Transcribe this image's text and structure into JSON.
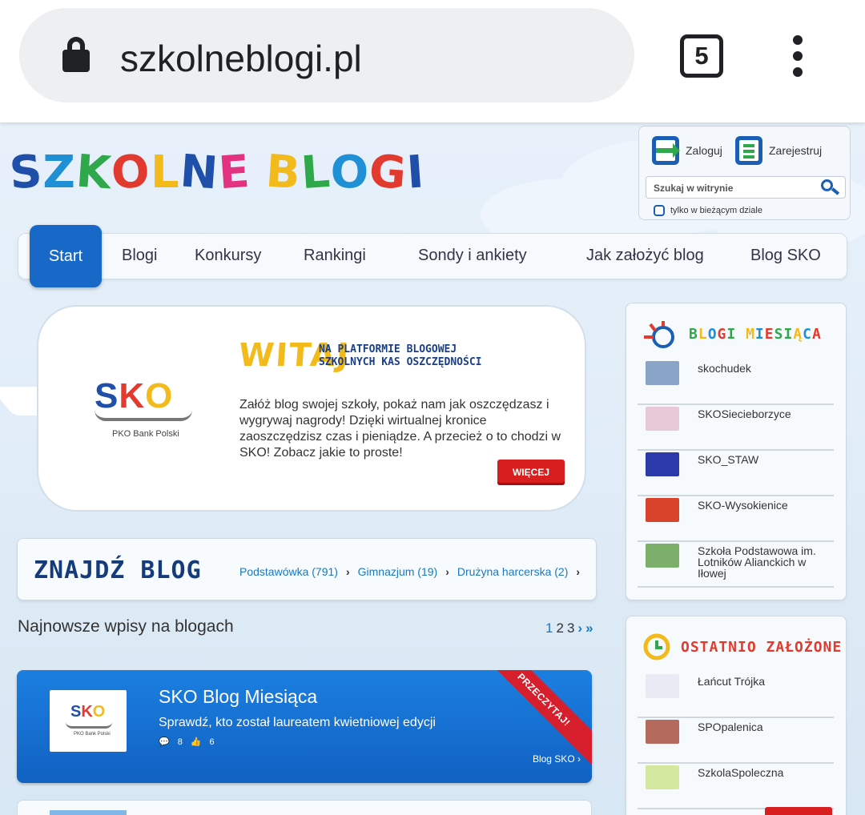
{
  "browser": {
    "url": "szkolneblogi.pl",
    "tab_count": "5"
  },
  "header": {
    "logo_letters": [
      "S",
      "Z",
      "K",
      "O",
      "L",
      "N",
      "E",
      " ",
      "B",
      "L",
      "O",
      "G",
      "I"
    ],
    "logo_colors": [
      "#1f4fa8",
      "#1f8fd6",
      "#2ea84a",
      "#e33a2f",
      "#f2ba1b",
      "#1f4fa8",
      "#e3327f",
      "#ffffff",
      "#f2ba1b",
      "#2ea84a",
      "#1f8fd6",
      "#e33a2f",
      "#1f4fa8"
    ]
  },
  "login": {
    "login_label": "Zaloguj",
    "register_label": "Zarejestruj",
    "search_placeholder": "Szukaj w witrynie",
    "checkbox_label": "tylko w bieżącym dziale"
  },
  "nav": {
    "items": [
      "Start",
      "Blogi",
      "Konkursy",
      "Rankingi",
      "Sondy i ankiety",
      "Jak założyć blog",
      "Blog SKO"
    ],
    "active": "Start"
  },
  "welcome": {
    "logo_text": "SKO",
    "logo_sub": "PKO Bank Polski",
    "title": "WITAJ",
    "subtitle": "NA PLATFORMIE BLOGOWEJ SZKOLNYCH KAS OSZCZĘDNOŚCI",
    "text": "Załóż blog swojej szkoły, pokaż nam jak oszczędzasz i wygrywaj nagrody! Dzięki wirtualnej kronice zaoszczędzisz czas i pieniądze. A przecież o to chodzi w SKO! Zobacz jakie to proste!",
    "more_button": "WIĘCEJ"
  },
  "find_blog": {
    "title": "ZNAJDŹ BLOG",
    "categories": [
      "Podstawówka (791)",
      "Gimnazjum (19)",
      "Drużyna harcerska (2)"
    ]
  },
  "latest": {
    "heading": "Najnowsze wpisy na blogach",
    "pages": [
      "1",
      "2",
      "3"
    ],
    "post": {
      "thumb_text": "SKO",
      "thumb_sub": "PKO Bank Polski",
      "title": "SKO Blog Miesiąca",
      "description": "Sprawdź, kto został laureatem kwietniowej edycji",
      "comments": "8",
      "likes": "6",
      "link": "Blog SKO",
      "ribbon": "PRZECZYTAJ!"
    }
  },
  "blogs_of_month": {
    "title": "BLOGI MIESIĄCA",
    "title_colors": [
      "#2ea84a",
      "#f2ba1b",
      "#1f8fd6",
      "#e33a2f",
      "#2ea84a"
    ],
    "items": [
      {
        "name": "skochudek",
        "color": "#8aa4c8"
      },
      {
        "name": "SKOSiecieborzyce",
        "color": "#e8c9d8"
      },
      {
        "name": "SKO_STAW",
        "color": "#2b3aa8"
      },
      {
        "name": "SKO-Wysokienice",
        "color": "#d8432c"
      },
      {
        "name": "Szkoła Podstawowa im. Lotników Alianckich w Iłowej",
        "color": "#7cb06a"
      }
    ]
  },
  "recently_created": {
    "title": "OSTATNIO ZAŁOŻONE",
    "items": [
      {
        "name": "Łańcut Trójka",
        "color": "#eaeaf4"
      },
      {
        "name": "SPOpalenica",
        "color": "#b46a5c"
      },
      {
        "name": "SzkolaSpoleczna",
        "color": "#d4e8a0"
      }
    ]
  }
}
